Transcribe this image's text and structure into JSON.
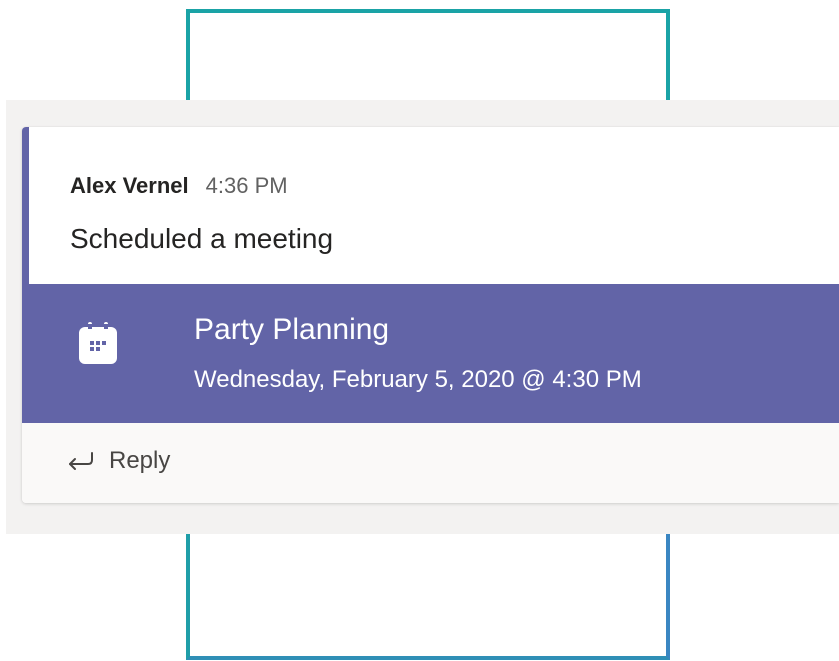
{
  "message": {
    "author": "Alex Vernel",
    "time": "4:36 PM",
    "text": "Scheduled a meeting"
  },
  "meeting": {
    "icon": "calendar-icon",
    "title": "Party Planning",
    "datetime": "Wednesday, February 5, 2020 @ 4:30 PM"
  },
  "actions": {
    "reply_icon": "reply-arrow-icon",
    "reply_label": "Reply"
  },
  "colors": {
    "accent": "#6264a7",
    "frame": "#1aa3a6"
  }
}
